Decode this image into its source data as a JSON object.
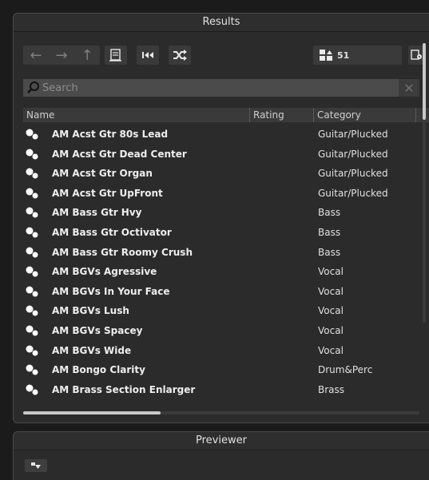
{
  "results_panel": {
    "title": "Results"
  },
  "toolbar": {
    "back_icon": "arrow-left-icon",
    "forward_icon": "arrow-right-icon",
    "up_icon": "arrow-up-icon",
    "result_count": "51"
  },
  "search": {
    "placeholder": "Search",
    "value": ""
  },
  "table": {
    "columns": [
      "Name",
      "Rating",
      "Category"
    ],
    "rows": [
      {
        "name": "AM Acst Gtr 80s Lead",
        "category": "Guitar/Plucked"
      },
      {
        "name": "AM Acst Gtr Dead Center",
        "category": "Guitar/Plucked"
      },
      {
        "name": "AM Acst Gtr Organ",
        "category": "Guitar/Plucked"
      },
      {
        "name": "AM Acst Gtr UpFront",
        "category": "Guitar/Plucked"
      },
      {
        "name": "AM Bass Gtr Hvy",
        "category": "Bass"
      },
      {
        "name": "AM Bass Gtr Octivator",
        "category": "Bass"
      },
      {
        "name": "AM Bass Gtr Roomy Crush",
        "category": "Bass"
      },
      {
        "name": "AM BGVs Agressive",
        "category": "Vocal"
      },
      {
        "name": "AM BGVs In Your Face",
        "category": "Vocal"
      },
      {
        "name": "AM BGVs Lush",
        "category": "Vocal"
      },
      {
        "name": "AM BGVs Spacey",
        "category": "Vocal"
      },
      {
        "name": "AM BGVs Wide",
        "category": "Vocal"
      },
      {
        "name": "AM Bongo Clarity",
        "category": "Drum&Perc"
      },
      {
        "name": "AM Brass Section Enlarger",
        "category": "Brass"
      }
    ]
  },
  "previewer_panel": {
    "title": "Previewer"
  },
  "colors": {
    "panel_bg": "#2b2b2b",
    "page_bg": "#1b1b1b",
    "text": "#e8e8e8"
  }
}
